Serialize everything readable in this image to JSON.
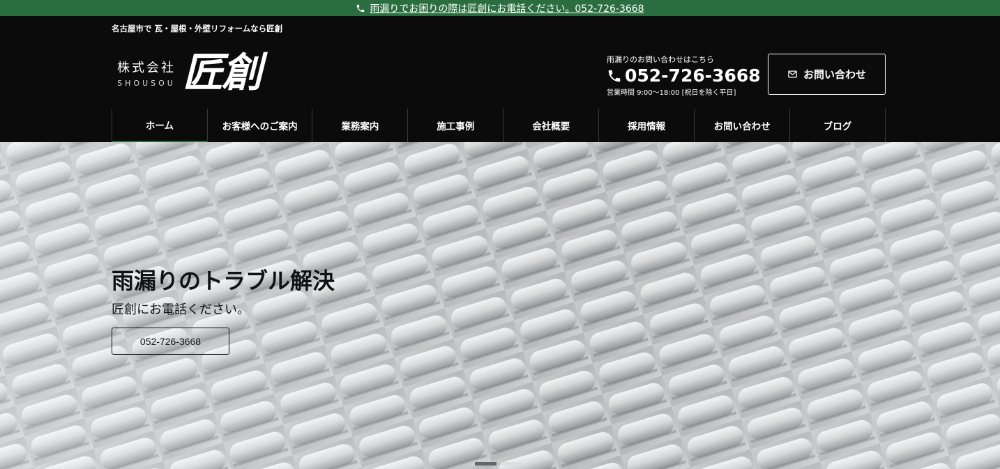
{
  "topbar": {
    "text": "雨漏りでお困りの際は匠創にお電話ください。052-726-3668"
  },
  "header": {
    "tagline": "名古屋市で 瓦・屋根・外壁リフォームなら匠創",
    "logo": {
      "jp": "株式会社",
      "en": "SHOUSOU",
      "mark": "匠創"
    },
    "contact": {
      "label": "雨漏りのお問い合わせはこちら",
      "phone": "052-726-3668",
      "hours": "営業時間 9:00〜18:00 [祝日を除く平日]"
    },
    "inquiry_button": "お問い合わせ"
  },
  "nav": [
    {
      "label": "ホーム"
    },
    {
      "label": "お客様へのご案内"
    },
    {
      "label": "業務案内"
    },
    {
      "label": "施工事例"
    },
    {
      "label": "会社概要"
    },
    {
      "label": "採用情報"
    },
    {
      "label": "お問い合わせ"
    },
    {
      "label": "ブログ"
    }
  ],
  "hero": {
    "title": "雨漏りのトラブル解決",
    "subtitle": "匠創にお電話ください。",
    "button": "052-726-3668",
    "slides": 2,
    "active_slide": 1
  },
  "colors": {
    "accent_green": "#2a6e3f",
    "header_bg": "#0b0b0b"
  }
}
